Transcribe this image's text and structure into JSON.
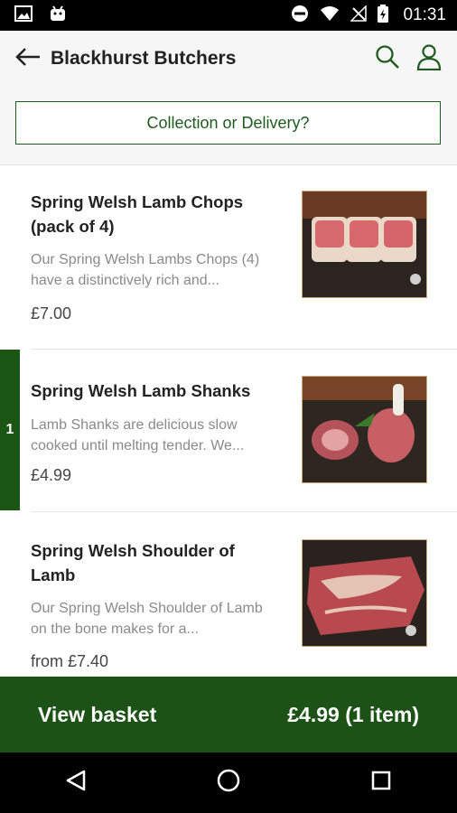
{
  "status_bar": {
    "time": "01:31"
  },
  "header": {
    "title": "Blackhurst Butchers",
    "icons": {
      "back": "arrow-left-icon",
      "search": "search-icon",
      "account": "person-icon"
    }
  },
  "collection_button": {
    "label": "Collection or Delivery?"
  },
  "products": [
    {
      "name": "Spring Welsh Lamb Chops (pack of 4)",
      "description": "Our Spring Welsh Lambs Chops (4) have a distinctively rich and...",
      "price": "£7.00"
    },
    {
      "name": "Spring Welsh Lamb Shanks",
      "description": "Lamb Shanks are delicious slow cooked until melting tender. We...",
      "price": "£4.99",
      "quantity_in_basket": "1"
    },
    {
      "name": "Spring Welsh Shoulder of Lamb",
      "description": "Our Spring Welsh Shoulder of Lamb on the bone makes for a...",
      "price": "from £7.40"
    }
  ],
  "basket": {
    "label": "View basket",
    "total": "£4.99 (1 item)"
  },
  "colors": {
    "brand_green": "#1c5215",
    "accent_green": "#1f5a1f"
  }
}
